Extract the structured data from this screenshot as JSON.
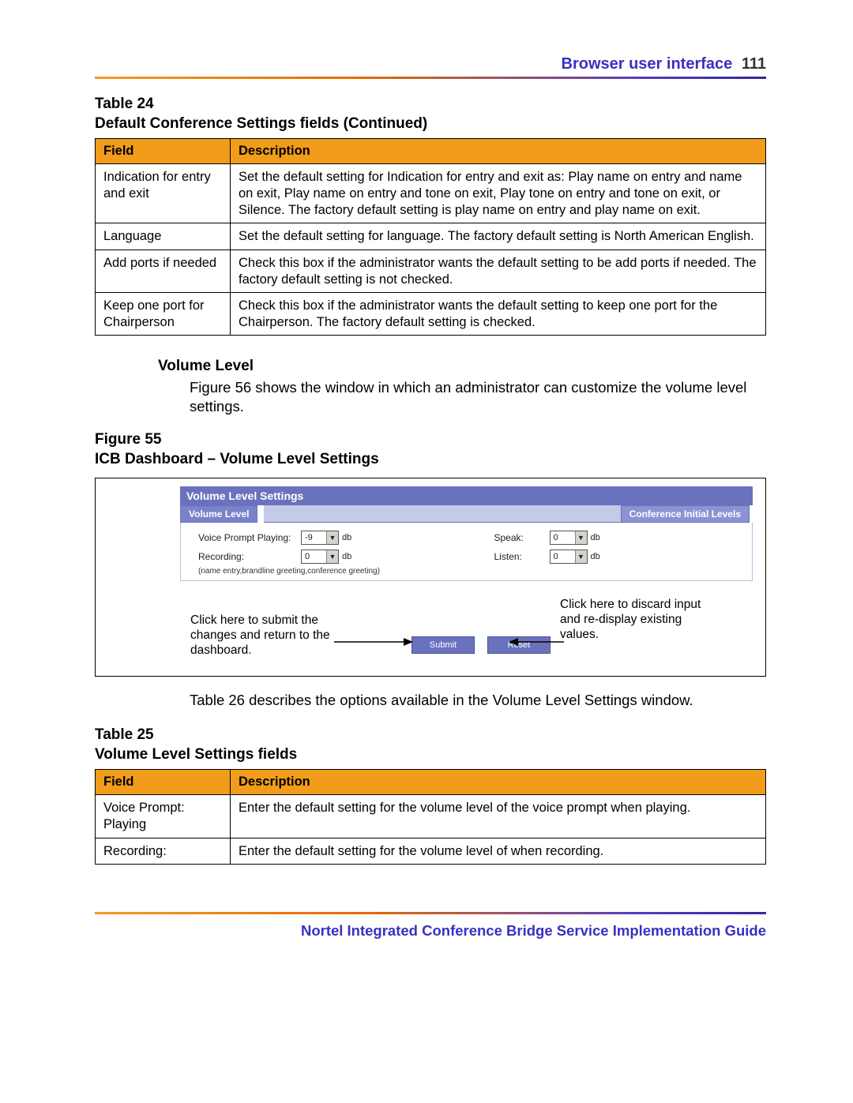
{
  "header": {
    "title": "Browser user interface",
    "page_number": "111"
  },
  "table24": {
    "caption_line1": "Table 24",
    "caption_line2": "Default Conference Settings fields (Continued)",
    "head_field": "Field",
    "head_desc": "Description",
    "rows": [
      {
        "field": "Indication for entry and exit",
        "desc": "Set the default setting for Indication for entry and exit as: Play name on entry and name on exit, Play name on entry and tone on exit, Play tone on entry and tone on exit, or Silence. The factory default setting is play name on entry and play name on exit."
      },
      {
        "field": "Language",
        "desc": "Set the default setting for language. The factory default setting is North American English."
      },
      {
        "field": "Add ports if needed",
        "desc": "Check this box if the administrator wants the default setting to be add ports if needed. The factory default setting is not checked."
      },
      {
        "field": "Keep one port for Chairperson",
        "desc": "Check this box if the administrator wants the default setting to keep one port for the Chairperson. The factory default setting is checked."
      }
    ]
  },
  "volume_section": {
    "heading": "Volume Level",
    "text": "Figure 56 shows the window in which an administrator can customize the volume level settings."
  },
  "figure": {
    "caption_line1": "Figure 55",
    "caption_line2": "ICB Dashboard – Volume Level Settings",
    "panel_title": "Volume Level Settings",
    "tab_left": "Volume Level",
    "tab_right": "Conference Initial Levels",
    "labels": {
      "voice_prompt": "Voice Prompt Playing:",
      "recording": "Recording:",
      "speak": "Speak:",
      "listen": "Listen:",
      "db": "db",
      "note": "(name entry,brandline greeting,conference greeting)"
    },
    "values": {
      "voice_prompt": "-9",
      "recording": "0",
      "speak": "0",
      "listen": "0"
    },
    "buttons": {
      "submit": "Submit",
      "reset": "Reset"
    },
    "callouts": {
      "left": "Click here to submit the changes and return to the dashboard.",
      "right": "Click here to discard input and re-display existing values."
    }
  },
  "post_figure_text": "Table 26 describes the options available in the Volume Level Settings window.",
  "table25": {
    "caption_line1": "Table 25",
    "caption_line2": "Volume Level Settings fields",
    "head_field": "Field",
    "head_desc": "Description",
    "rows": [
      {
        "field": "Voice Prompt: Playing",
        "desc": "Enter the default setting for the volume level of the voice prompt when playing."
      },
      {
        "field": "Recording:",
        "desc": "Enter the default setting for the volume level of when recording."
      }
    ]
  },
  "footer": {
    "title": "Nortel Integrated Conference Bridge Service Implementation Guide"
  }
}
